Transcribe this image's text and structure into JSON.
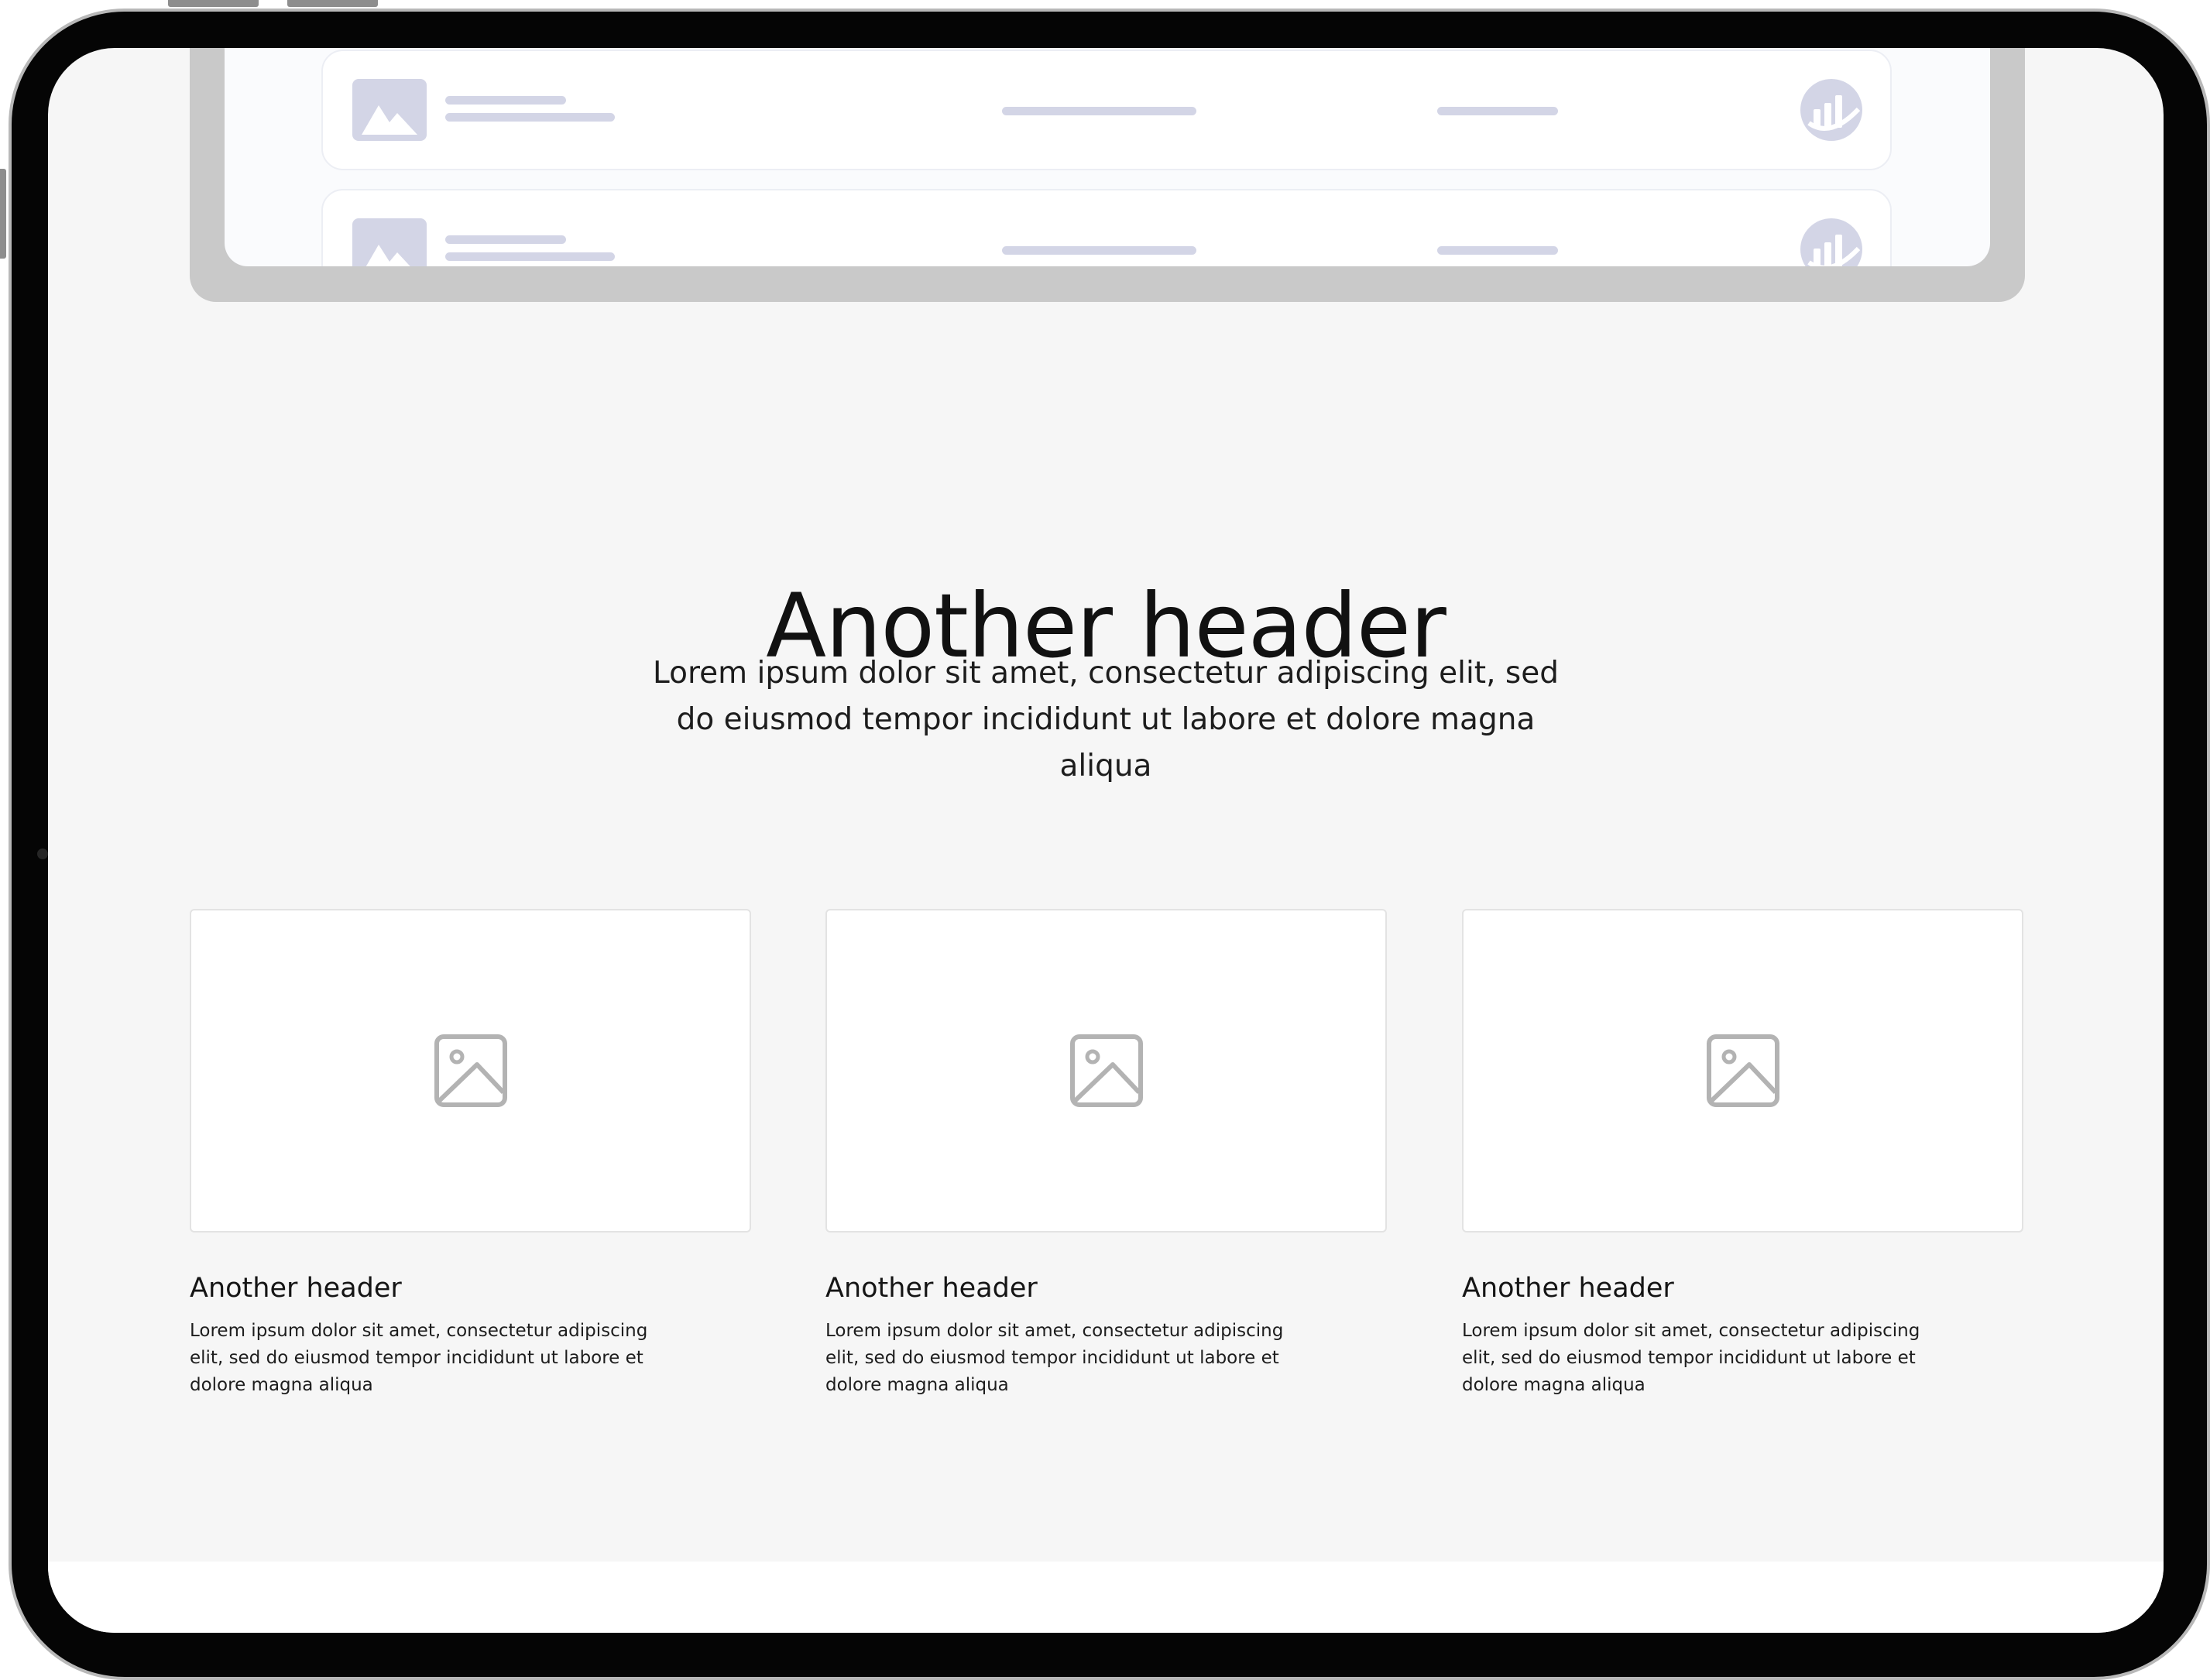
{
  "section": {
    "title": "Another header",
    "subtitle": "Lorem ipsum dolor sit amet, consectetur adipiscing elit, sed do eiusmod tempor incididunt ut labore et dolore magna aliqua"
  },
  "cards": [
    {
      "icon": "image-placeholder-icon",
      "title": "Another header",
      "body": "Lorem ipsum dolor sit amet, consectetur adipiscing elit, sed do eiusmod tempor incididunt ut labore et dolore magna aliqua"
    },
    {
      "icon": "image-placeholder-icon",
      "title": "Another header",
      "body": "Lorem ipsum dolor sit amet, consectetur adipiscing elit, sed do eiusmod tempor incididunt ut labore et dolore magna aliqua"
    },
    {
      "icon": "image-placeholder-icon",
      "title": "Another header",
      "body": "Lorem ipsum dolor sit amet, consectetur adipiscing elit, sed do eiusmod tempor incididunt ut labore et dolore magna aliqua"
    }
  ],
  "mock_list": {
    "row_icons": [
      "image-thumbnail-icon",
      "chart-icon"
    ]
  },
  "colors": {
    "background": "#f6f6f6",
    "device_frame": "#050505",
    "placeholder_accent": "#d3d5e6",
    "icon_gray": "#b3b3b3",
    "text": "#111111"
  }
}
